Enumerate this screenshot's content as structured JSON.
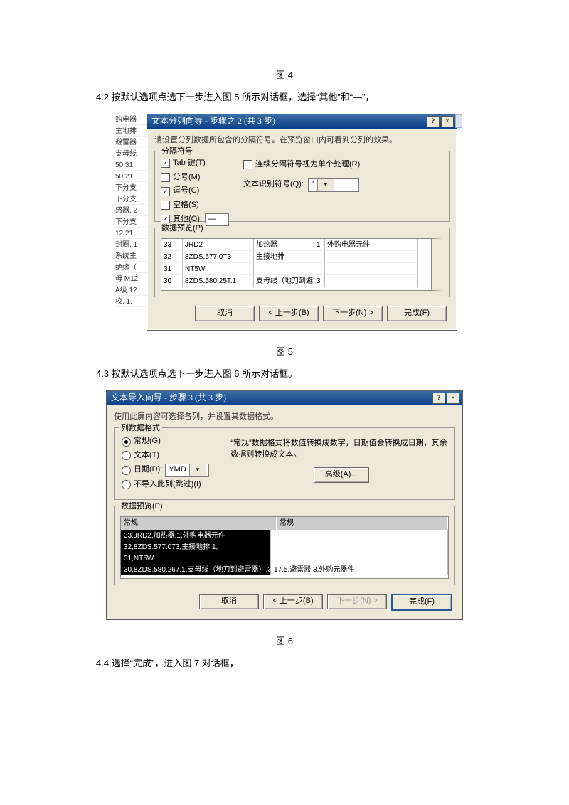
{
  "captions": {
    "fig4": "图 4",
    "fig5": "图 5",
    "fig6": "图 6"
  },
  "t42": "4.2  按默认选项点选下一步进入图 5 所示对话框，选择“其他”和“—”，",
  "t43": "4.3  按默认选项点选下一步进入图 6 所示对话框。",
  "t44": "4.4  选择“完成”，进入图 7 对话框，",
  "d1": {
    "title": "文本分列向导 - 步骤之 2 (共 3 步)",
    "hint": "请设置分列数据所包含的分隔符号。在预览窗口内可看到分列的效果。",
    "group_delim": "分隔符号",
    "chk_tab": "Tab 键(T)",
    "chk_semicolon": "分号(M)",
    "chk_comma": "逗号(C)",
    "chk_space": "空格(S)",
    "chk_other": "其他(O):",
    "other_value": "—",
    "chk_consecutive": "连续分隔符号视为单个处理(R)",
    "lbl_qualifier": "文本识别符号(Q):",
    "qualifier_value": "\"",
    "group_preview": "数据预览(P)",
    "preview_rows": [
      [
        "33",
        "JRD2",
        "加热器",
        "1",
        "外购电器元件"
      ],
      [
        "32",
        "8ZDS.577.0T3",
        "主接地排",
        "",
        ""
      ],
      [
        "31",
        "NT5W",
        "",
        "",
        ""
      ],
      [
        "30",
        "8ZDS.580.25T.1",
        "支母线（地刀到避雷器）",
        "3",
        ""
      ]
    ],
    "btn_cancel": "取消",
    "btn_back": "< 上一步(B)",
    "btn_next": "下一步(N) >",
    "btn_finish": "完成(F)",
    "sheet_rows": [
      "购电器",
      "主地排",
      "避雷器",
      "支母线",
      "50  31",
      "50  21",
      "下分支",
      "下分支",
      "感器, 2",
      "下分支",
      "  12 21",
      "封圈, 1",
      "系统主",
      "绝缘（",
      "母 M12",
      "A级  12",
      "校, 1,"
    ]
  },
  "d2": {
    "title": "文本导入向导 - 步骤 3 (共 3 步)",
    "hint": "使用此屏内容可选择各列，并设置其数据格式。",
    "group_format": "列数据格式",
    "opt_general": "常规(G)",
    "opt_text": "文本(T)",
    "opt_date": "日期(D):",
    "date_value": "YMD",
    "opt_skip": "不导入此列(跳过)(I)",
    "desc": "“常规”数据格式将数值转换成数字，日期值会转换成日期，其余数据则转换成文本。",
    "btn_advanced": "高级(A)...",
    "group_preview": "数据预览(P)",
    "hdr_col1": "常规",
    "hdr_col2": "常规",
    "col1_rows": [
      "33,JRD2,加热器,1,外购电器元件",
      "32,8ZDS.577.073,主接地排,1,",
      "31,NT5W",
      "30,8ZDS.580.267.1,支母线（地刀到避雷器）,3,"
    ],
    "col2_rows": [
      "",
      "",
      "",
      "17.5,避雷器,3,外购元器件"
    ],
    "btn_cancel": "取消",
    "btn_back": "< 上一步(B)",
    "btn_next": "下一步(N) >",
    "btn_finish": "完成(F)"
  }
}
